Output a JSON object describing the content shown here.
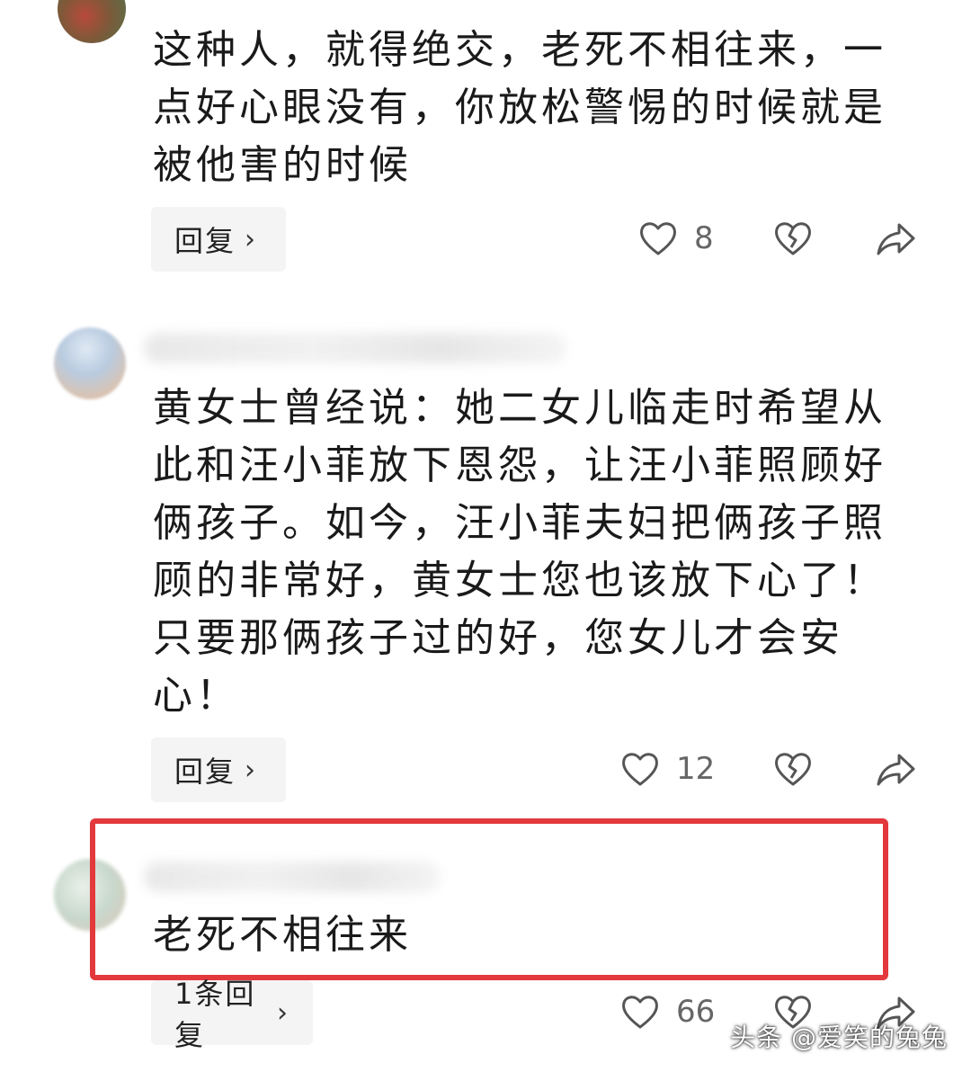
{
  "comments": [
    {
      "text": "这种人，就得绝交，老死不相往来，一点好心眼没有，你放松警惕的时候就是被他害的时候",
      "reply_label": "回复",
      "likes": "8"
    },
    {
      "text": "黄女士曾经说：她二女儿临走时希望从此和汪小菲放下恩怨，让汪小菲照顾好俩孩子。如今，汪小菲夫妇把俩孩子照顾的非常好，黄女士您也该放下心了！只要那俩孩子过的好，您女儿才会安心！",
      "reply_label": "回复",
      "likes": "12"
    },
    {
      "text": "老死不相往来",
      "reply_label": "1条回复",
      "likes": "66"
    }
  ],
  "icons": {
    "reply_chevron": "chevron-right-icon",
    "like": "heart-icon",
    "dislike": "broken-heart-icon",
    "share": "share-icon"
  },
  "colors": {
    "highlight_border": "#e3393d",
    "pill_background": "#f4f4f4",
    "text": "#1a1a1a",
    "icon": "#555555"
  },
  "watermark": "头条 @爱笑的兔兔"
}
